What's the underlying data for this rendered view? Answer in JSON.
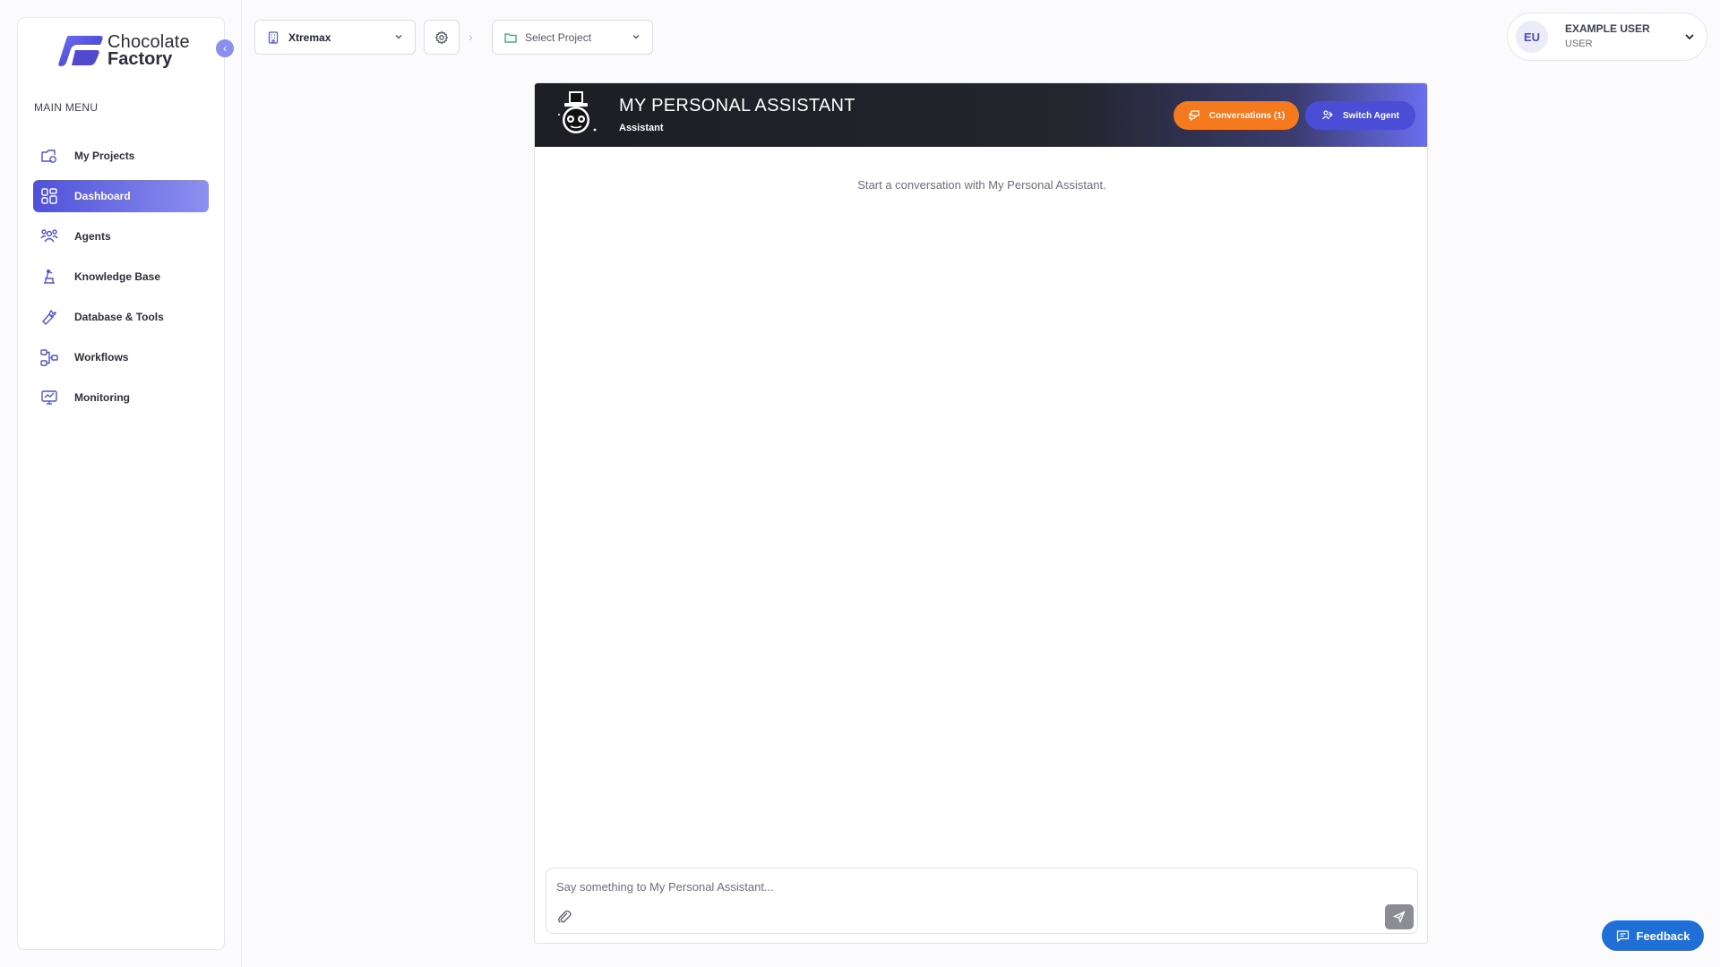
{
  "brand": {
    "line1": "Chocolate",
    "line2": "Factory",
    "icon": "chocolate-factory-logo"
  },
  "sidebar": {
    "menu_title": "MAIN MENU",
    "items": [
      {
        "label": "My Projects",
        "icon": "projects-icon",
        "active": false
      },
      {
        "label": "Dashboard",
        "icon": "dashboard-icon",
        "active": true
      },
      {
        "label": "Agents",
        "icon": "agents-icon",
        "active": false
      },
      {
        "label": "Knowledge Base",
        "icon": "knowledge-base-icon",
        "active": false
      },
      {
        "label": "Database & Tools",
        "icon": "wrench-icon",
        "active": false
      },
      {
        "label": "Workflows",
        "icon": "workflows-icon",
        "active": false
      },
      {
        "label": "Monitoring",
        "icon": "monitoring-icon",
        "active": false
      }
    ]
  },
  "topbar": {
    "organization": "Xtremax",
    "project_placeholder": "Select Project"
  },
  "user": {
    "initials": "EU",
    "name": "EXAMPLE USER",
    "role": "USER"
  },
  "chat": {
    "agent_name": "MY PERSONAL ASSISTANT",
    "agent_role": "Assistant",
    "conversations_label": "Conversations (1)",
    "switch_agent_label": "Switch Agent",
    "empty_message": "Start a conversation with My Personal Assistant.",
    "input_placeholder": "Say something to My Personal Assistant..."
  },
  "feedback_label": "Feedback",
  "colors": {
    "accent": "#4f52d9",
    "conversations_button": "#f57a1f",
    "switch_agent_button": "#4a4dd6",
    "feedback_button": "#1f6fd6"
  }
}
